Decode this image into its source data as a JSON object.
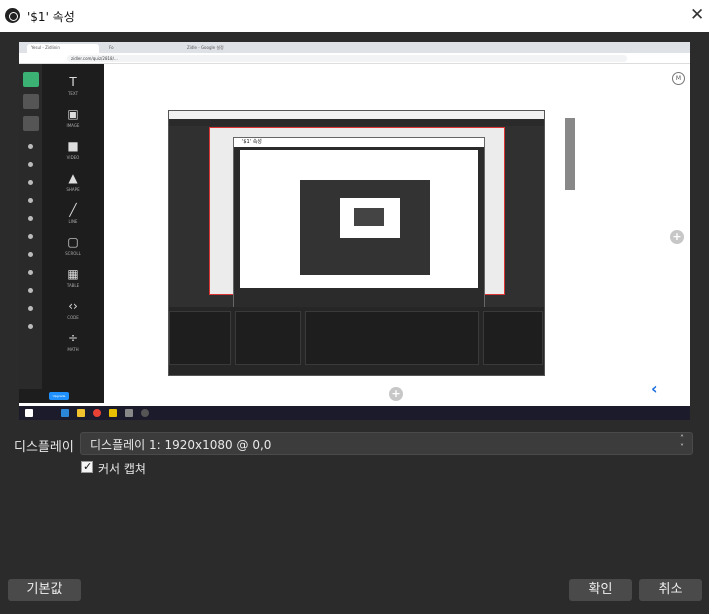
{
  "window": {
    "title": "'$1' 속성",
    "close_glyph": "✕"
  },
  "preview_content": {
    "browser_tabs": [
      "Yesul - Zidlinin",
      "Fo",
      "Zidle - Google 설정"
    ],
    "url": "zidler.com/quiz/2818/...",
    "avatar_initial": "M",
    "tools": [
      {
        "glyph": "T",
        "label": "TEXT"
      },
      {
        "glyph": "▣",
        "label": "IMAGE"
      },
      {
        "glyph": "■",
        "label": "VIDEO"
      },
      {
        "glyph": "▲",
        "label": "SHAPE"
      },
      {
        "glyph": "╱",
        "label": "LINE"
      },
      {
        "glyph": "▢",
        "label": "SCROLL"
      },
      {
        "glyph": "▦",
        "label": "TABLE"
      },
      {
        "glyph": "‹›",
        "label": "CODE"
      },
      {
        "glyph": "÷",
        "label": "MATH"
      }
    ],
    "upgrade_label": "Upgrade",
    "nested_dialog_title": "'$1' 속성"
  },
  "form": {
    "display_label": "디스플레이",
    "display_value": "디스플레이 1: 1920x1080 @ 0,0",
    "capture_cursor_label": "커서 캡쳐",
    "capture_cursor_checked": true
  },
  "buttons": {
    "defaults": "기본값",
    "ok": "확인",
    "cancel": "취소"
  },
  "colors": {
    "dialog_bg": "#2b2b2b",
    "button_bg": "#4a4a4a",
    "accent_green": "#3bb273",
    "accent_blue": "#1e6fe0"
  }
}
